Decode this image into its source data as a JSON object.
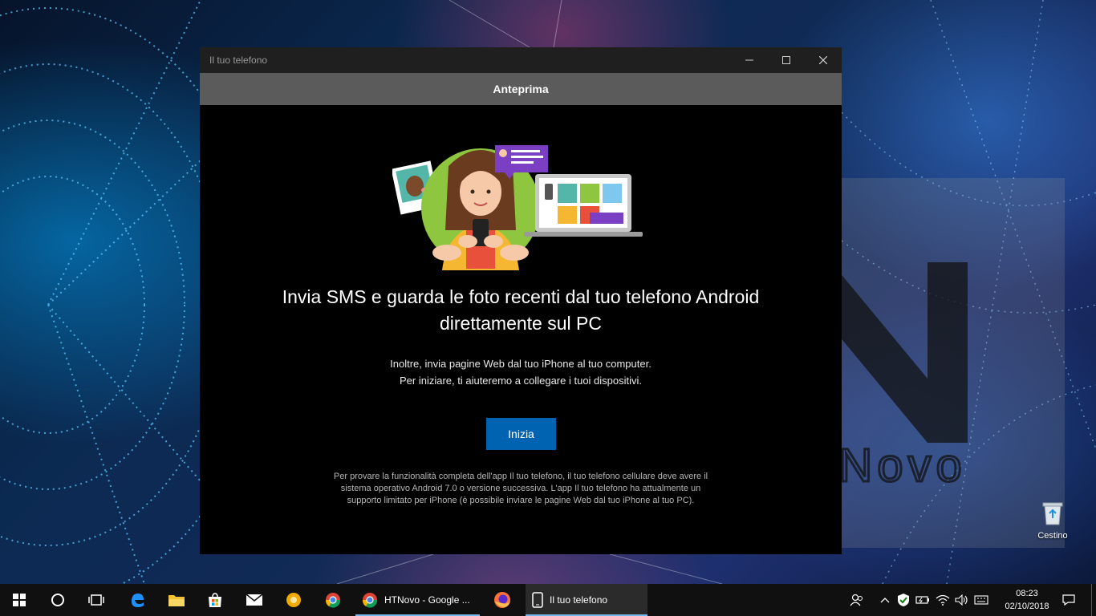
{
  "window": {
    "title": "Il tuo telefono",
    "banner": "Anteprima",
    "headline_line1": "Invia SMS e guarda le foto recenti dal tuo telefono Android",
    "headline_line2": "direttamente sul PC",
    "sub_line1": "Inoltre, invia pagine Web dal tuo iPhone al tuo computer.",
    "sub_line2": "Per iniziare, ti aiuteremo a collegare i tuoi dispositivi.",
    "start_label": "Inizia",
    "fine_print": "Per provare la funzionalità completa dell'app Il tuo telefono, il tuo telefono cellulare deve avere il sistema operativo Android 7.0 o versione successiva. L'app Il tuo telefono ha attualmente un supporto limitato per iPhone (è possibile inviare le pagine Web dal tuo iPhone al tuo PC)."
  },
  "watermark": {
    "text": "HTNovo",
    "letter": "N"
  },
  "desktop": {
    "recycle_bin": "Cestino"
  },
  "taskbar": {
    "apps": [
      {
        "label": "HTNovo - Google ..."
      },
      {
        "label": "Il tuo telefono"
      }
    ],
    "clock": {
      "time": "08:23",
      "date": "02/10/2018"
    }
  },
  "colors": {
    "accent": "#0063b1",
    "banner": "#5b5b5b",
    "window_bg": "#000000"
  }
}
